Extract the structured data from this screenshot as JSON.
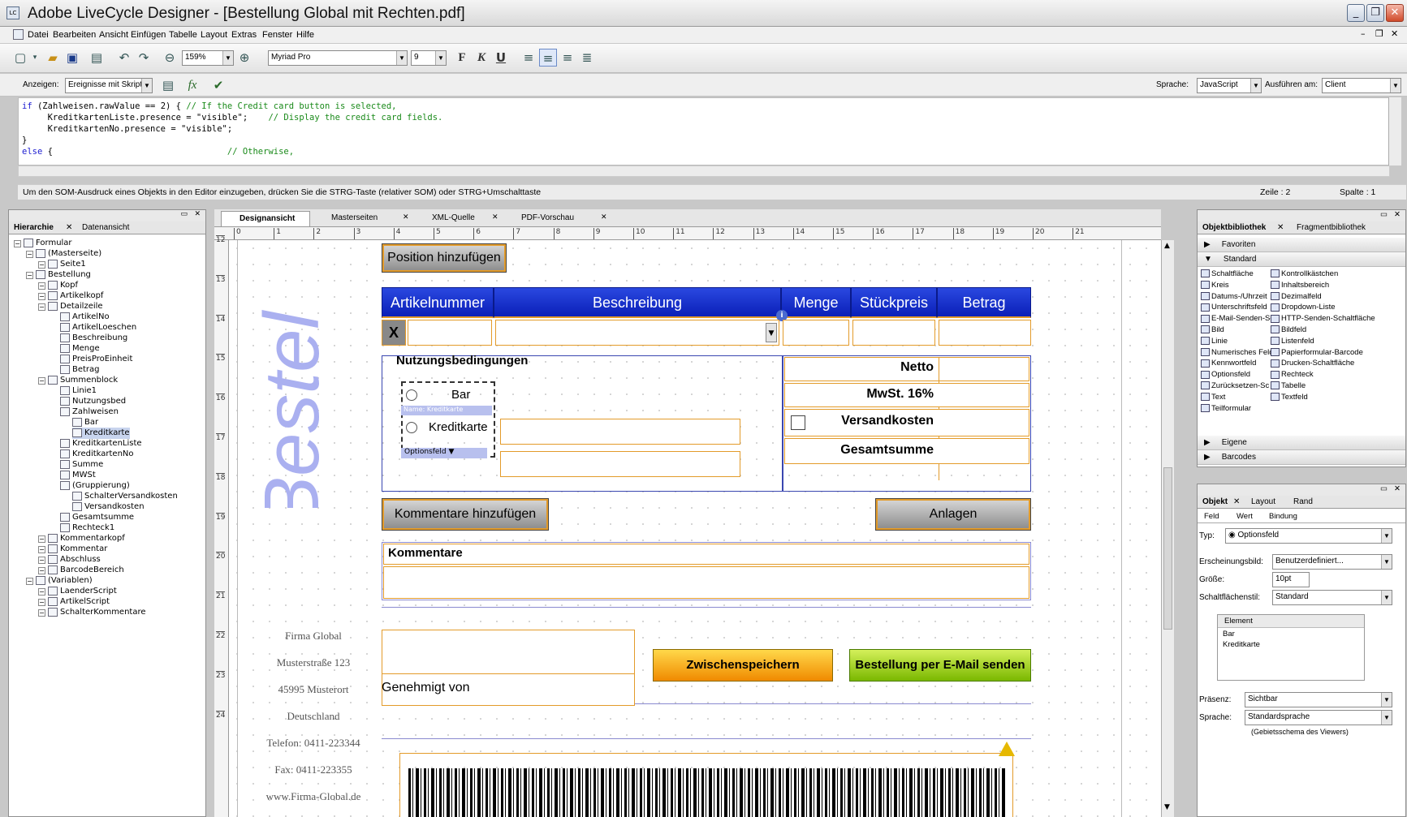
{
  "window": {
    "title": "Adobe LiveCycle Designer - [Bestellung Global mit Rechten.pdf]"
  },
  "menu": [
    "Datei",
    "Bearbeiten",
    "Ansicht",
    "Einfügen",
    "Tabelle",
    "Layout",
    "Extras",
    "Fenster",
    "Hilfe"
  ],
  "toolbar": {
    "zoom": "159%",
    "font": "Myriad Pro",
    "size": "9",
    "bold": "F",
    "italic": "K",
    "underline": "U"
  },
  "scriptbar": {
    "show_label": "Anzeigen:",
    "show_value": "Ereignisse mit Skript",
    "lang_label": "Sprache:",
    "lang_value": "JavaScript",
    "run_label": "Ausführen am:",
    "run_value": "Client"
  },
  "code": {
    "l1a": "if",
    "l1b": " (Zahlweisen.rawValue == 2) { ",
    "l1c": "// If the Credit card button is selected,",
    "l2a": "     KreditkartenListe.presence = \"visible\";    ",
    "l2b": "// Display the credit card fields.",
    "l3": "     KreditkartenNo.presence = \"visible\";",
    "l4": "}",
    "l5a": "else",
    "l5b": " {                                  ",
    "l5c": "// Otherwise,"
  },
  "status": {
    "hint": "Um den SOM-Ausdruck eines Objekts in den Editor einzugeben, drücken Sie die STRG-Taste (relativer SOM) oder STRG+Umschalttaste",
    "line": "Zeile : 2",
    "col": "Spalte : 1"
  },
  "left_panel": {
    "tabs": [
      "Hierarchie",
      "Datenansicht"
    ],
    "tree": [
      {
        "label": "Formular",
        "level": 0
      },
      {
        "label": "(Masterseite)",
        "level": 1
      },
      {
        "label": "Seite1",
        "level": 2
      },
      {
        "label": "Bestellung",
        "level": 1
      },
      {
        "label": "Kopf",
        "level": 2
      },
      {
        "label": "Artikelkopf",
        "level": 2
      },
      {
        "label": "Detailzeile",
        "level": 2
      },
      {
        "label": "ArtikelNo",
        "level": 3
      },
      {
        "label": "ArtikelLoeschen",
        "level": 3
      },
      {
        "label": "Beschreibung",
        "level": 3
      },
      {
        "label": "Menge",
        "level": 3
      },
      {
        "label": "PreisProEinheit",
        "level": 3
      },
      {
        "label": "Betrag",
        "level": 3
      },
      {
        "label": "Summenblock",
        "level": 2
      },
      {
        "label": "Linie1",
        "level": 3
      },
      {
        "label": "Nutzungsbed",
        "level": 3
      },
      {
        "label": "Zahlweisen",
        "level": 3
      },
      {
        "label": "Bar",
        "level": 4
      },
      {
        "label": "Kreditkarte",
        "level": 4
      },
      {
        "label": "KreditkartenListe",
        "level": 3
      },
      {
        "label": "KreditkartenNo",
        "level": 3
      },
      {
        "label": "Summe",
        "level": 3
      },
      {
        "label": "MWSt",
        "level": 3
      },
      {
        "label": "(Gruppierung)",
        "level": 3
      },
      {
        "label": "SchalterVersandkosten",
        "level": 4
      },
      {
        "label": "Versandkosten",
        "level": 4
      },
      {
        "label": "Gesamtsumme",
        "level": 3
      },
      {
        "label": "Rechteck1",
        "level": 3
      },
      {
        "label": "Kommentarkopf",
        "level": 2
      },
      {
        "label": "Kommentar",
        "level": 2
      },
      {
        "label": "Abschluss",
        "level": 2
      },
      {
        "label": "BarcodeBereich",
        "level": 2
      },
      {
        "label": "(Variablen)",
        "level": 1
      },
      {
        "label": "LaenderScript",
        "level": 2
      },
      {
        "label": "ArtikelScript",
        "level": 2
      },
      {
        "label": "SchalterKommentare",
        "level": 2
      }
    ]
  },
  "doc_tabs": [
    "Designansicht",
    "Masterseiten",
    "XML-Quelle",
    "PDF-Vorschau"
  ],
  "ruler": [
    "0",
    "1",
    "2",
    "3",
    "4",
    "5",
    "6",
    "7",
    "8",
    "9",
    "10",
    "11",
    "12",
    "13",
    "14",
    "15",
    "16",
    "17",
    "18",
    "19",
    "20",
    "21"
  ],
  "vruler": [
    "12",
    "13",
    "14",
    "15",
    "16",
    "17",
    "18",
    "19",
    "20",
    "21",
    "22",
    "23",
    "24"
  ],
  "form": {
    "watermark": "Bestel",
    "add_position": "Position hinzufügen",
    "headers": [
      "Artikelnummer",
      "Beschreibung",
      "Menge",
      "Stückpreis",
      "Betrag"
    ],
    "delete_x": "X",
    "terms_title": "Nutzungsbedingungen",
    "radio_bar": "Bar",
    "radio_card": "Kreditkarte",
    "name_tag": "Name: Kreditkarte",
    "options_tag": "Optionsfeld",
    "netto": "Netto",
    "mwst": "MwSt. 16%",
    "versand": "Versandkosten",
    "gesamt": "Gesamtsumme",
    "add_comment": "Kommentare hinzufügen",
    "attachments": "Anlagen",
    "comments_title": "Kommentare",
    "approved_by": "Genehmigt von",
    "save_btn": "Zwischenspeichern",
    "email_btn": "Bestellung per E-Mail senden",
    "address": [
      "Firma Global",
      "Musterstraße 123",
      "45995 Musterort",
      "Deutschland",
      "Telefon: 0411-223344",
      "Fax: 0411-223355",
      "www.Firma-Global.de"
    ]
  },
  "library": {
    "tabs": [
      "Objektbibliothek",
      "Fragmentbibliothek"
    ],
    "sections": [
      "Favoriten",
      "Standard",
      "Eigene",
      "Barcodes"
    ],
    "left_items": [
      "Schaltfläche",
      "Kreis",
      "Datums-/Uhrzeit",
      "Unterschriftsfeld",
      "E-Mail-Senden-Sch",
      "Bild",
      "Linie",
      "Numerisches Feld",
      "Kennwortfeld",
      "Optionsfeld",
      "Zurücksetzen-Sc",
      "Text",
      "Teilformular"
    ],
    "right_items": [
      "Kontrollkästchen",
      "Inhaltsbereich",
      "Dezimalfeld",
      "Dropdown-Liste",
      "HTTP-Senden-Schaltfläche",
      "Bildfeld",
      "Listenfeld",
      "Papierformular-Barcode",
      "Drucken-Schaltfläche",
      "Rechteck",
      "Tabelle",
      "Textfeld"
    ]
  },
  "object": {
    "tabs": [
      "Objekt",
      "Layout",
      "Rand"
    ],
    "subtabs": [
      "Feld",
      "Wert",
      "Bindung"
    ],
    "type_label": "Typ:",
    "type_value": "Optionsfeld",
    "appearance_label": "Erscheinungsbild:",
    "appearance_value": "Benutzerdefiniert...",
    "size_label": "Größe:",
    "size_value": "10pt",
    "style_label": "Schaltflächenstil:",
    "style_value": "Standard",
    "element_header": "Element",
    "elements": [
      "Bar",
      "Kreditkarte"
    ],
    "presence_label": "Präsenz:",
    "presence_value": "Sichtbar",
    "lang_label": "Sprache:",
    "lang_value": "Standardsprache",
    "lang_note": "(Gebietsschema des Viewers)"
  }
}
